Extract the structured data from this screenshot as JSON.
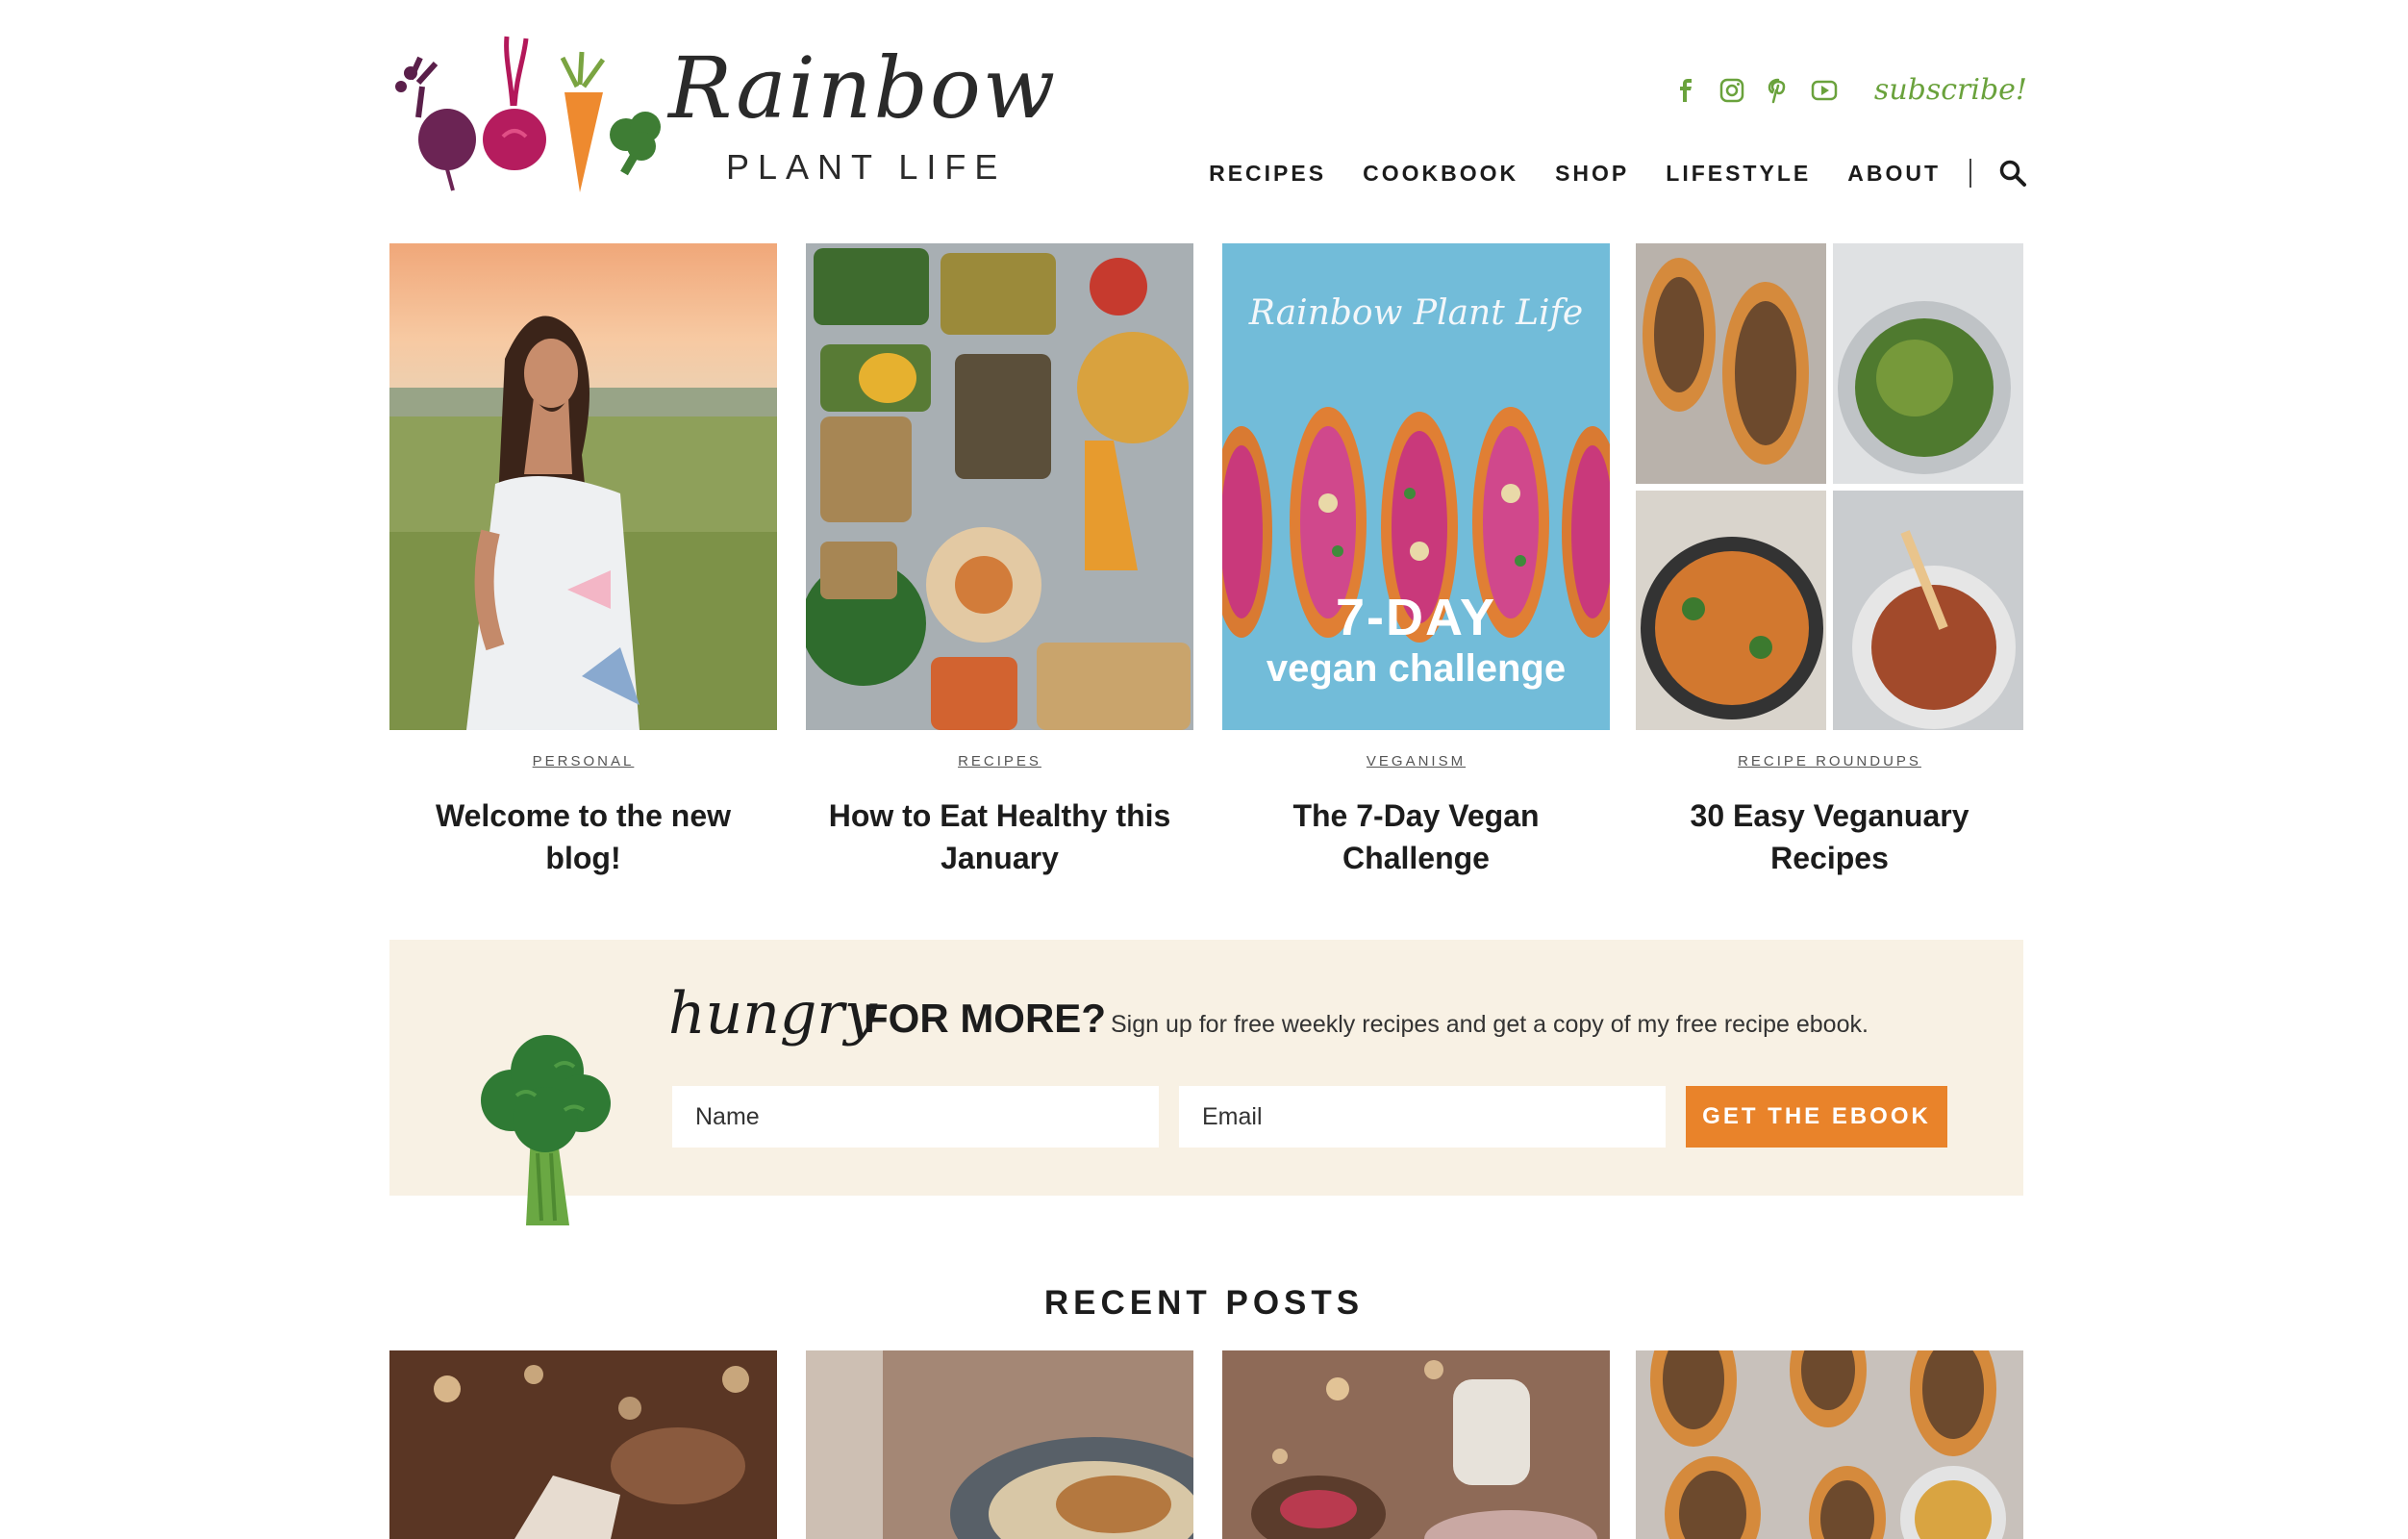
{
  "site": {
    "name_script": "Rainbow",
    "name_sub": "PLANT LIFE"
  },
  "social": {
    "icons": [
      "facebook-icon",
      "instagram-icon",
      "pinterest-icon",
      "youtube-icon"
    ],
    "subscribe_label": "subscribe!",
    "accent_color": "#6aa23c"
  },
  "nav": {
    "items": [
      {
        "label": "RECIPES"
      },
      {
        "label": "COOKBOOK"
      },
      {
        "label": "SHOP"
      },
      {
        "label": "LIFESTYLE"
      },
      {
        "label": "ABOUT"
      }
    ],
    "search_icon": "search-icon"
  },
  "featured": [
    {
      "category": "PERSONAL",
      "title": "Welcome to the new blog!"
    },
    {
      "category": "RECIPES",
      "title": "How to Eat Healthy this January"
    },
    {
      "category": "VEGANISM",
      "title": "The 7-Day Vegan Challenge",
      "overlay_brand": "Rainbow Plant Life",
      "overlay_big": "7-DAY",
      "overlay_small": "vegan challenge"
    },
    {
      "category": "RECIPE ROUNDUPS",
      "title": "30 Easy Veganuary Recipes"
    }
  ],
  "newsletter": {
    "hungry": "hungry",
    "for_more": "FOR MORE?",
    "description": "Sign up for free weekly recipes and get a copy of my free recipe ebook.",
    "name_placeholder": "Name",
    "email_placeholder": "Email",
    "button_label": "GET THE EBOOK",
    "background": "#f8f1e4",
    "button_color": "#e9832a"
  },
  "recent": {
    "heading": "RECENT POSTS"
  }
}
